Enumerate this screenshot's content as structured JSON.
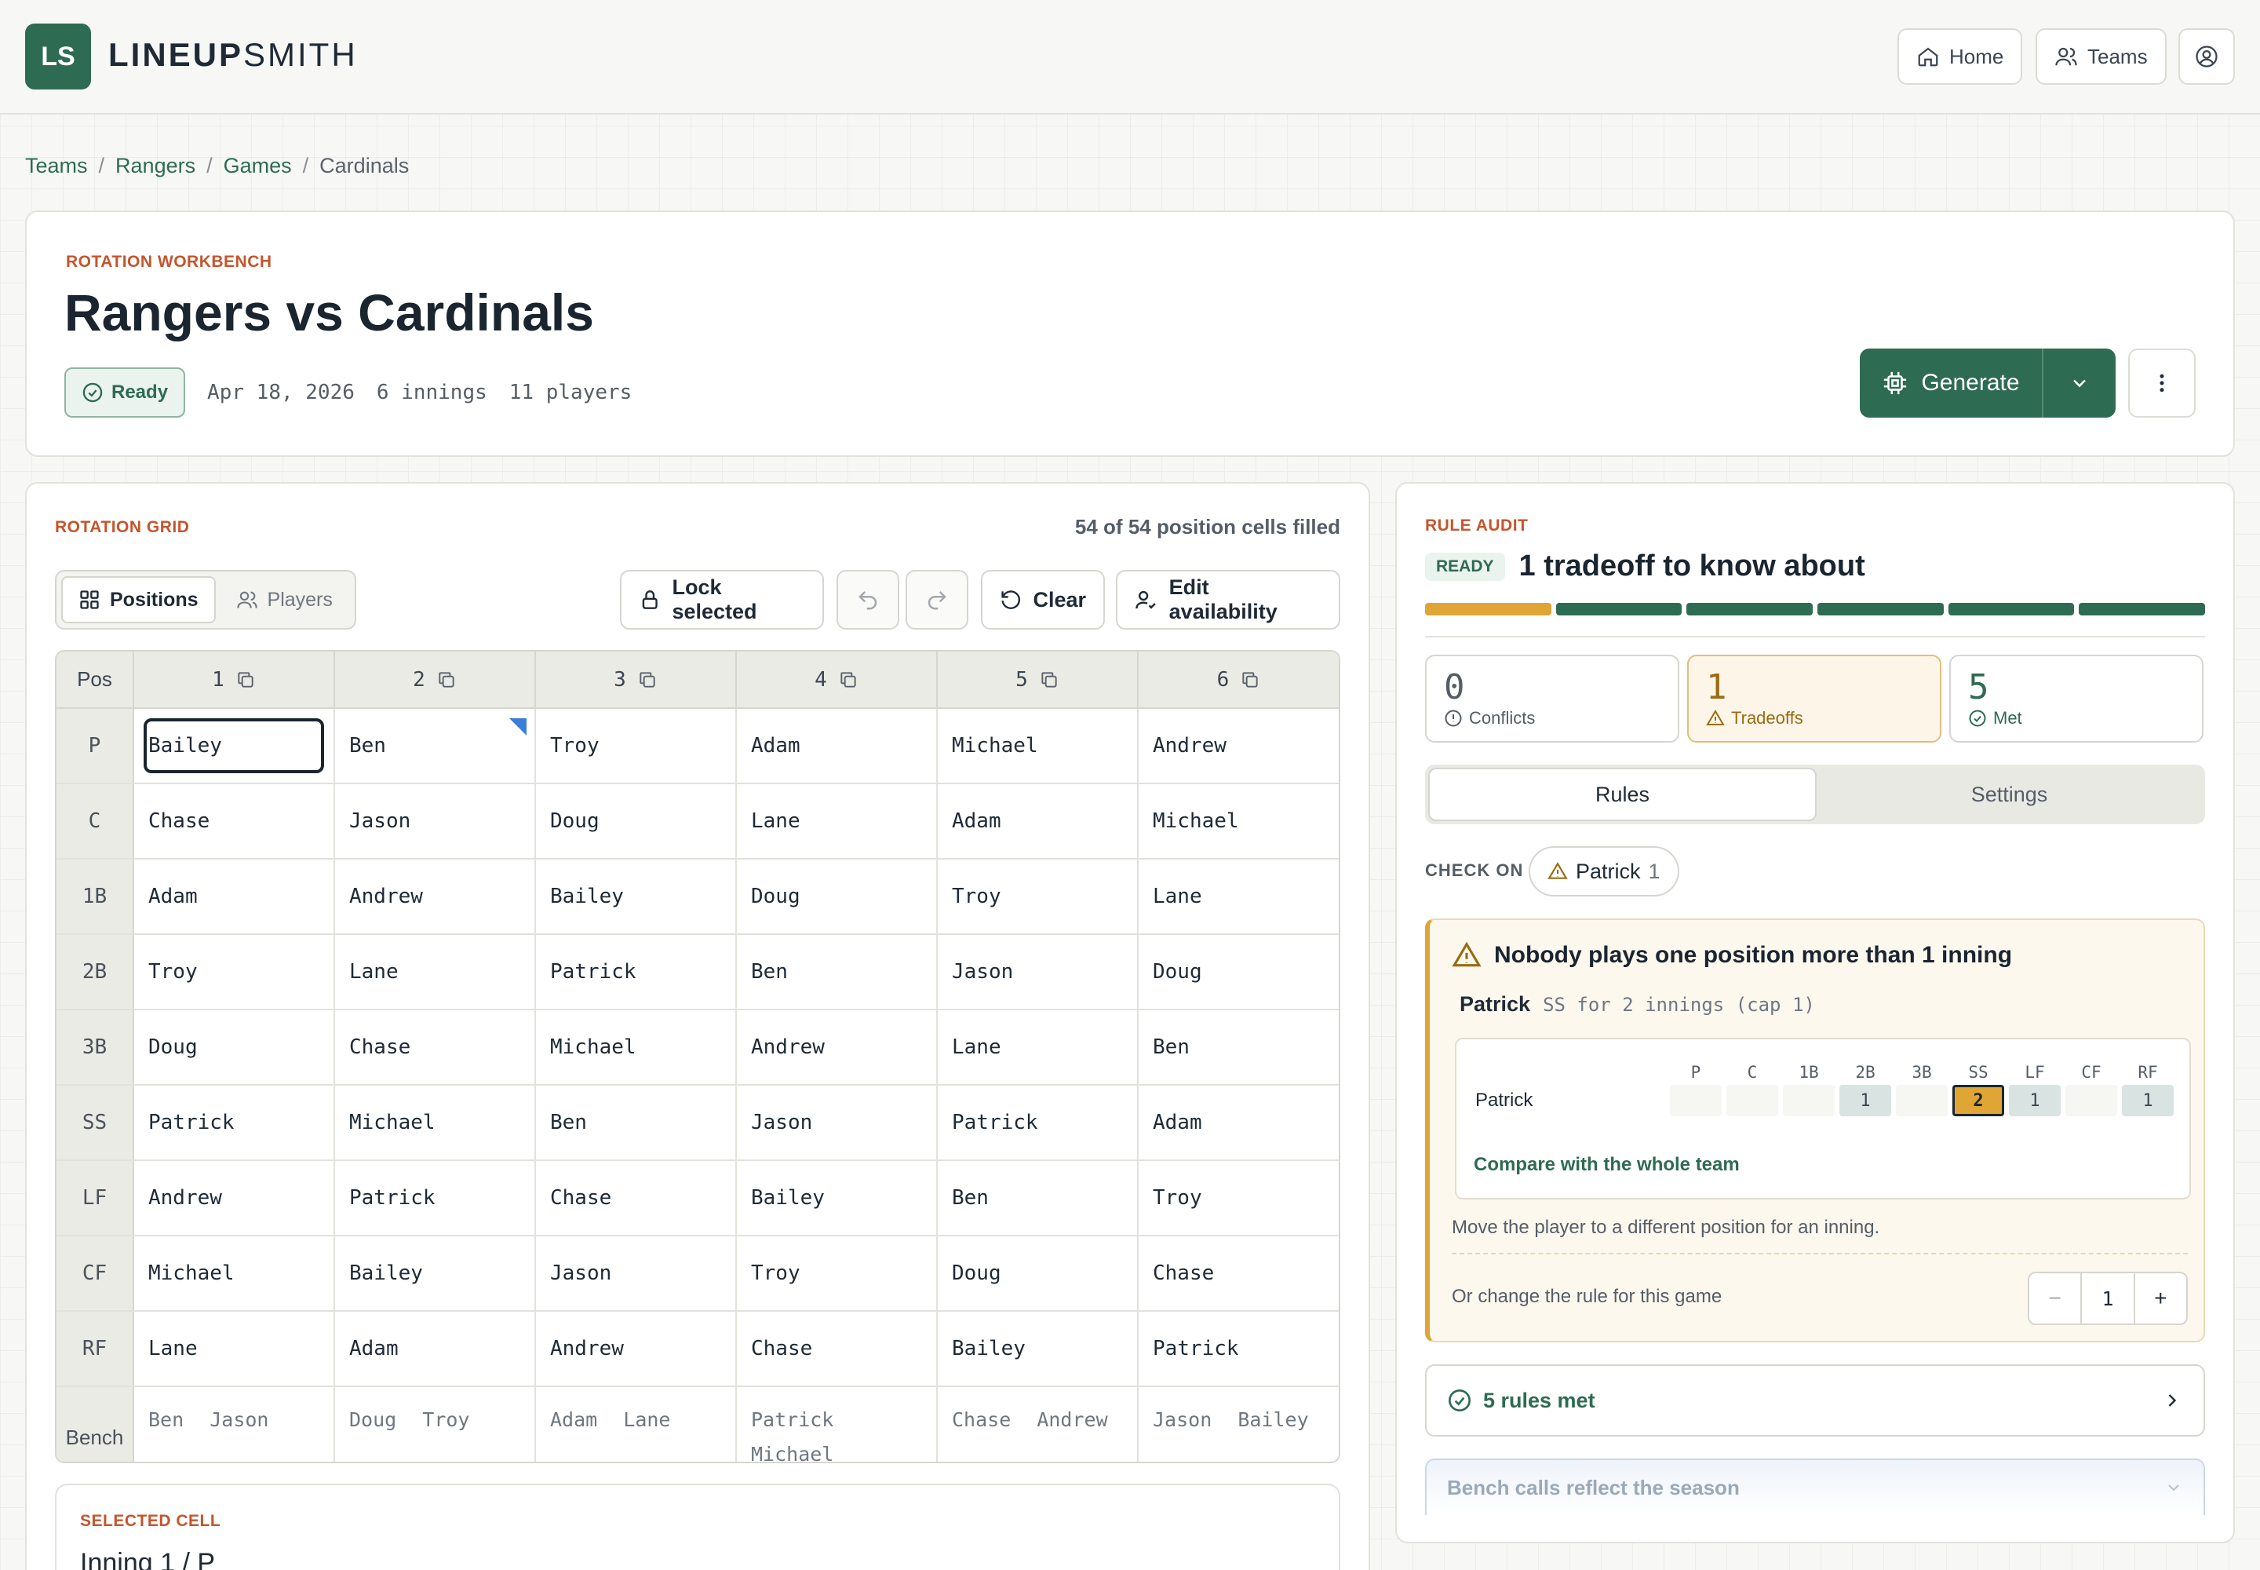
{
  "app": {
    "logo_text": "LS",
    "brand_bold": "LINEUP",
    "brand_light": "SMITH"
  },
  "nav": {
    "home": "Home",
    "teams": "Teams"
  },
  "breadcrumb": [
    "Teams",
    "Rangers",
    "Games",
    "Cardinals"
  ],
  "header": {
    "kicker": "ROTATION WORKBENCH",
    "title": "Rangers vs Cardinals",
    "status": "Ready",
    "date": "Apr 18, 2026",
    "innings": "6 innings",
    "players": "11 players",
    "generate_label": "Generate"
  },
  "grid": {
    "kicker": "ROTATION GRID",
    "filled_status": "54 of 54 position cells filled",
    "view_positions": "Positions",
    "view_players": "Players",
    "lock_label": "Lock selected",
    "clear_label": "Clear",
    "edit_label": "Edit availability",
    "pos_header": "Pos",
    "innings": [
      "1",
      "2",
      "3",
      "4",
      "5",
      "6"
    ],
    "rows": [
      {
        "pos": "P",
        "cells": [
          "Bailey",
          "Ben",
          "Troy",
          "Adam",
          "Michael",
          "Andrew"
        ]
      },
      {
        "pos": "C",
        "cells": [
          "Chase",
          "Jason",
          "Doug",
          "Lane",
          "Adam",
          "Michael"
        ]
      },
      {
        "pos": "1B",
        "cells": [
          "Adam",
          "Andrew",
          "Bailey",
          "Doug",
          "Troy",
          "Lane"
        ]
      },
      {
        "pos": "2B",
        "cells": [
          "Troy",
          "Lane",
          "Patrick",
          "Ben",
          "Jason",
          "Doug"
        ]
      },
      {
        "pos": "3B",
        "cells": [
          "Doug",
          "Chase",
          "Michael",
          "Andrew",
          "Lane",
          "Ben"
        ]
      },
      {
        "pos": "SS",
        "cells": [
          "Patrick",
          "Michael",
          "Ben",
          "Jason",
          "Patrick",
          "Adam"
        ]
      },
      {
        "pos": "LF",
        "cells": [
          "Andrew",
          "Patrick",
          "Chase",
          "Bailey",
          "Ben",
          "Troy"
        ]
      },
      {
        "pos": "CF",
        "cells": [
          "Michael",
          "Bailey",
          "Jason",
          "Troy",
          "Doug",
          "Chase"
        ]
      },
      {
        "pos": "RF",
        "cells": [
          "Lane",
          "Adam",
          "Andrew",
          "Chase",
          "Bailey",
          "Patrick"
        ]
      }
    ],
    "bench_label": "Bench",
    "bench": [
      [
        "Ben",
        "Jason"
      ],
      [
        "Doug",
        "Troy"
      ],
      [
        "Adam",
        "Lane"
      ],
      [
        "Patrick",
        "Michael"
      ],
      [
        "Chase",
        "Andrew"
      ],
      [
        "Jason",
        "Bailey"
      ]
    ]
  },
  "selected": {
    "kicker": "SELECTED CELL",
    "title": "Inning 1 / P"
  },
  "audit": {
    "kicker": "RULE AUDIT",
    "badge": "READY",
    "headline": "1 tradeoff to know about",
    "progress": {
      "tradeoff_segments": 1,
      "met_segments": 5
    },
    "stats": [
      {
        "num": "0",
        "label": "Conflicts"
      },
      {
        "num": "1",
        "label": "Tradeoffs"
      },
      {
        "num": "5",
        "label": "Met"
      }
    ],
    "tabs": [
      "Rules",
      "Settings"
    ],
    "check_on_label": "CHECK ON",
    "check_on_player": "Patrick",
    "check_on_count": "1",
    "rule_title": "Nobody plays one position more than 1 inning",
    "rule_player": "Patrick",
    "rule_detail": "SS for 2 innings (cap 1)",
    "mini_positions": [
      "P",
      "C",
      "1B",
      "2B",
      "3B",
      "SS",
      "LF",
      "CF",
      "RF"
    ],
    "mini_player": "Patrick",
    "mini_counts": [
      "",
      "",
      "",
      "1",
      "",
      "2",
      "1",
      "",
      "1"
    ],
    "compare_link": "Compare with the whole team",
    "suggestion": "Move the player to a different position for an inning.",
    "change_rule": "Or change the rule for this game",
    "stepper_value": "1",
    "rules_met": "5 rules met",
    "faded_rule": "Bench calls reflect the season"
  },
  "colors": {
    "brand": "#2e6b53",
    "accent": "#c4552c",
    "warn": "#e0a635"
  }
}
